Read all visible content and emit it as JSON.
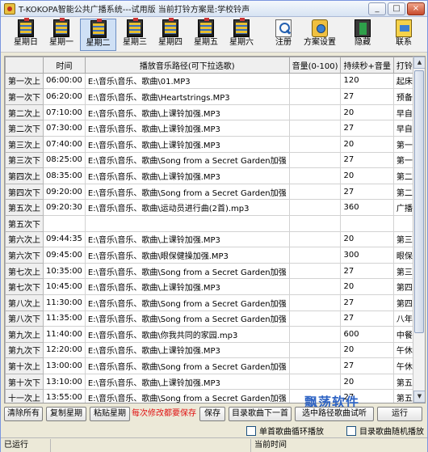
{
  "window": {
    "title": "T-KOKOPA智能公共广播系统---试用版   当前打铃方案是:学校铃声",
    "btn_min": "_",
    "btn_max": "□",
    "btn_close": "×"
  },
  "toolbar": {
    "days": [
      "星期日",
      "星期一",
      "星期二",
      "星期三",
      "星期四",
      "星期五",
      "星期六"
    ],
    "active_day_index": 2,
    "register": "注册",
    "scheme_settings": "方案设置",
    "hide": "隐藏",
    "contact": "联系"
  },
  "grid": {
    "headers": [
      "",
      "时间",
      "播放音乐路径(可下拉选歌)",
      "音量(0-100)",
      "持续秒+音量",
      "打铃事件名称"
    ],
    "rows": [
      {
        "label": "第一次上",
        "time": "06:00:00",
        "path": "E:\\音乐\\音乐、歌曲\\01.MP3",
        "volume": "",
        "duration": "120",
        "event": "起床铃声"
      },
      {
        "label": "第一次下",
        "time": "06:20:00",
        "path": "E:\\音乐\\音乐、歌曲\\Heartstrings.MP3",
        "volume": "",
        "duration": "27",
        "event": "预备铃"
      },
      {
        "label": "第二次上",
        "time": "07:10:00",
        "path": "E:\\音乐\\音乐、歌曲\\上课铃加强.MP3",
        "volume": "",
        "duration": "20",
        "event": "早自修上课"
      },
      {
        "label": "第二次下",
        "time": "07:30:00",
        "path": "E:\\音乐\\音乐、歌曲\\上课铃加强.MP3",
        "volume": "",
        "duration": "27",
        "event": "早自修下课"
      },
      {
        "label": "第三次上",
        "time": "07:40:00",
        "path": "E:\\音乐\\音乐、歌曲\\上课铃加强.MP3",
        "volume": "",
        "duration": "20",
        "event": "第一节课开始"
      },
      {
        "label": "第三次下",
        "time": "08:25:00",
        "path": "E:\\音乐\\音乐、歌曲\\Song from a Secret Garden加强",
        "volume": "",
        "duration": "27",
        "event": "第一节课结束"
      },
      {
        "label": "第四次上",
        "time": "08:35:00",
        "path": "E:\\音乐\\音乐、歌曲\\上课铃加强.MP3",
        "volume": "",
        "duration": "20",
        "event": "第二节课开始"
      },
      {
        "label": "第四次下",
        "time": "09:20:00",
        "path": "E:\\音乐\\音乐、歌曲\\Song from a Secret Garden加强",
        "volume": "",
        "duration": "27",
        "event": "第二节课下课"
      },
      {
        "label": "第五次上",
        "time": "09:20:30",
        "path": "E:\\音乐\\音乐、歌曲\\运动员进行曲(2首).mp3",
        "volume": "",
        "duration": "360",
        "event": "广播体操"
      },
      {
        "label": "第五次下",
        "time": "",
        "path": "",
        "volume": "",
        "duration": "",
        "event": ""
      },
      {
        "label": "第六次上",
        "time": "09:44:35",
        "path": "E:\\音乐\\音乐、歌曲\\上课铃加强.MP3",
        "volume": "",
        "duration": "20",
        "event": "第三节课上课"
      },
      {
        "label": "第六次下",
        "time": "09:45:00",
        "path": "E:\\音乐\\音乐、歌曲\\眼保健操加强.MP3",
        "volume": "",
        "duration": "300",
        "event": "眼保健操"
      },
      {
        "label": "第七次上",
        "time": "10:35:00",
        "path": "E:\\音乐\\音乐、歌曲\\Song from a Secret Garden加强",
        "volume": "",
        "duration": "27",
        "event": "第三节下课"
      },
      {
        "label": "第七次下",
        "time": "10:45:00",
        "path": "E:\\音乐\\音乐、歌曲\\上课铃加强.MP3",
        "volume": "",
        "duration": "20",
        "event": "第四节课上课"
      },
      {
        "label": "第八次上",
        "time": "11:30:00",
        "path": "E:\\音乐\\音乐、歌曲\\Song from a Secret Garden加强",
        "volume": "",
        "duration": "27",
        "event": "第四节课下课"
      },
      {
        "label": "第八次下",
        "time": "11:35:00",
        "path": "E:\\音乐\\音乐、歌曲\\Song from a Secret Garden加强",
        "volume": "",
        "duration": "27",
        "event": "八年级中餐"
      },
      {
        "label": "第九次上",
        "time": "11:40:00",
        "path": "E:\\音乐\\音乐、歌曲\\你我共同的家园.mp3",
        "volume": "",
        "duration": "600",
        "event": "中餐音乐"
      },
      {
        "label": "第九次下",
        "time": "12:20:00",
        "path": "E:\\音乐\\音乐、歌曲\\上课铃加强.MP3",
        "volume": "",
        "duration": "20",
        "event": "午休上课"
      },
      {
        "label": "第十次上",
        "time": "13:00:00",
        "path": "E:\\音乐\\音乐、歌曲\\Song from a Secret Garden加强",
        "volume": "",
        "duration": "27",
        "event": "午休下课"
      },
      {
        "label": "第十次下",
        "time": "13:10:00",
        "path": "E:\\音乐\\音乐、歌曲\\上课铃加强.MP3",
        "volume": "",
        "duration": "20",
        "event": "第五节课开始"
      },
      {
        "label": "十一次上",
        "time": "13:55:00",
        "path": "E:\\音乐\\音乐、歌曲\\Song from a Secret Garden加强",
        "volume": "",
        "duration": "27",
        "event": "第五节课结束"
      }
    ]
  },
  "buttons": {
    "clear_all": "清除所有",
    "copy_day": "复制星期",
    "paste_day": "粘贴星期",
    "warning": "每次修改都要保存",
    "save": "保存",
    "dir_next_song": "目录歌曲下一首",
    "path_test": "选中路径歌曲试听",
    "run": "运行"
  },
  "options": {
    "single_loop": "单首歌曲循环播放",
    "dir_random": "目录歌曲随机播放"
  },
  "watermark": "飘荡软件",
  "status": {
    "left": "已运行",
    "middle": "",
    "right": "当前时间"
  }
}
